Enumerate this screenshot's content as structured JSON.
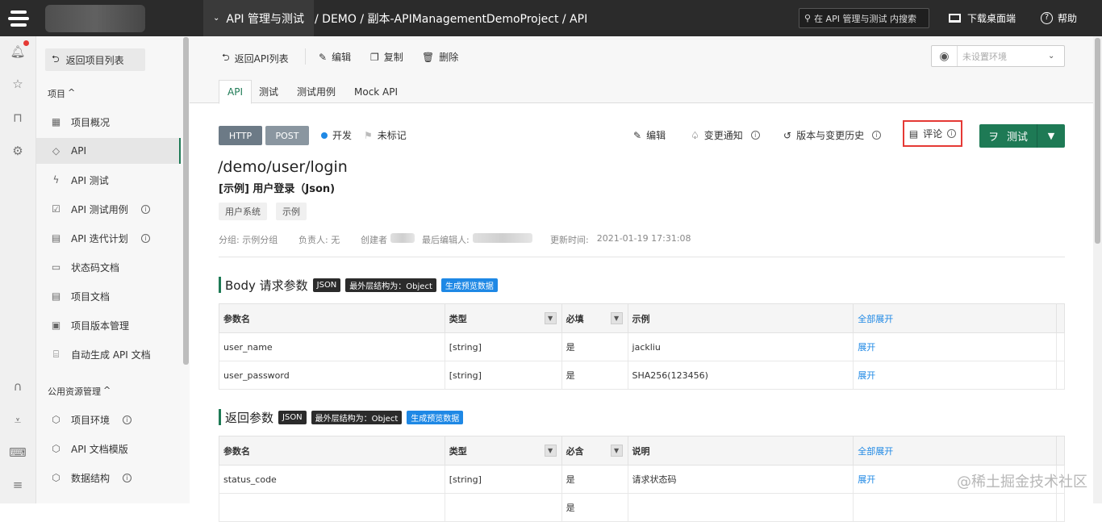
{
  "topbar": {
    "project_menu": "API 管理与测试",
    "breadcrumb": " / DEMO / 副本-APIManagementDemoProject / API",
    "search_placeholder": "在 API 管理与测试 内搜索",
    "download": "下载桌面端",
    "help": "帮助"
  },
  "sidebar": {
    "back": "返回项目列表",
    "section_project": "项目",
    "items": [
      {
        "label": "项目概况",
        "icon": "overview-icon",
        "info": false
      },
      {
        "label": "API",
        "icon": "api-icon",
        "info": false
      },
      {
        "label": "API 测试",
        "icon": "bolt-icon",
        "info": false
      },
      {
        "label": "API 测试用例",
        "icon": "checklist-icon",
        "info": true
      },
      {
        "label": "API 迭代计划",
        "icon": "calendar-icon",
        "info": true
      },
      {
        "label": "状态码文档",
        "icon": "doc-icon",
        "info": false
      },
      {
        "label": "项目文档",
        "icon": "file-icon",
        "info": false
      },
      {
        "label": "项目版本管理",
        "icon": "version-icon",
        "info": false
      },
      {
        "label": "自动生成 API 文档",
        "icon": "robot-icon",
        "info": false
      }
    ],
    "section_public": "公用资源管理",
    "public_items": [
      {
        "label": "项目环境",
        "info": true
      },
      {
        "label": "API 文档模版",
        "info": false
      },
      {
        "label": "数据结构",
        "info": true
      }
    ],
    "caret": "^"
  },
  "toolbar": {
    "back": "返回API列表",
    "edit": "编辑",
    "copy": "复制",
    "delete": "删除",
    "env_placeholder": "未设置环境"
  },
  "tabs": [
    "API",
    "测试",
    "测试用例",
    "Mock API"
  ],
  "api": {
    "protocol": "HTTP",
    "method": "POST",
    "status": "开发",
    "mark": "未标记",
    "actions": {
      "edit": "编辑",
      "notify": "变更通知",
      "history": "版本与变更历史",
      "comment": "评论",
      "test": "测试"
    },
    "path": "/demo/user/login",
    "name": "[示例] 用户登录（Json)",
    "tags": [
      "用户系统",
      "示例"
    ],
    "meta": {
      "group": "分组: 示例分组",
      "owner": "负责人: 无",
      "creator": "创建者",
      "editor": "最后编辑人: ",
      "updated_label": "更新时间:",
      "updated_value": "2021-01-19 17:31:08"
    }
  },
  "body_params": {
    "title": "Body 请求参数",
    "badge_json": "JSON",
    "badge_struct": "最外层结构为：Object",
    "badge_preview": "生成预览数据",
    "headers": [
      "参数名",
      "类型",
      "必填",
      "示例",
      "全部展开"
    ],
    "rows": [
      {
        "name": "user_name",
        "type": "[string]",
        "required": "是",
        "example": "jackliu",
        "action": "展开"
      },
      {
        "name": "user_password",
        "type": "[string]",
        "required": "是",
        "example": "SHA256(123456)",
        "action": "展开"
      }
    ]
  },
  "response_params": {
    "title": "返回参数",
    "badge_json": "JSON",
    "badge_struct": "最外层结构为：Object",
    "badge_preview": "生成预览数据",
    "headers": [
      "参数名",
      "类型",
      "必含",
      "说明",
      "全部展开"
    ],
    "rows": [
      {
        "name": "status_code",
        "type": "[string]",
        "required": "是",
        "desc": "请求状态码",
        "action": "展开"
      },
      {
        "name": "",
        "type": "",
        "required": "是",
        "desc": "",
        "action": ""
      }
    ]
  },
  "watermark": "@稀土掘金技术社区",
  "colors": {
    "accent": "#1e7a55",
    "link": "#1e88e5",
    "topbar": "#2b2b2b",
    "highlight": "#e53935"
  }
}
